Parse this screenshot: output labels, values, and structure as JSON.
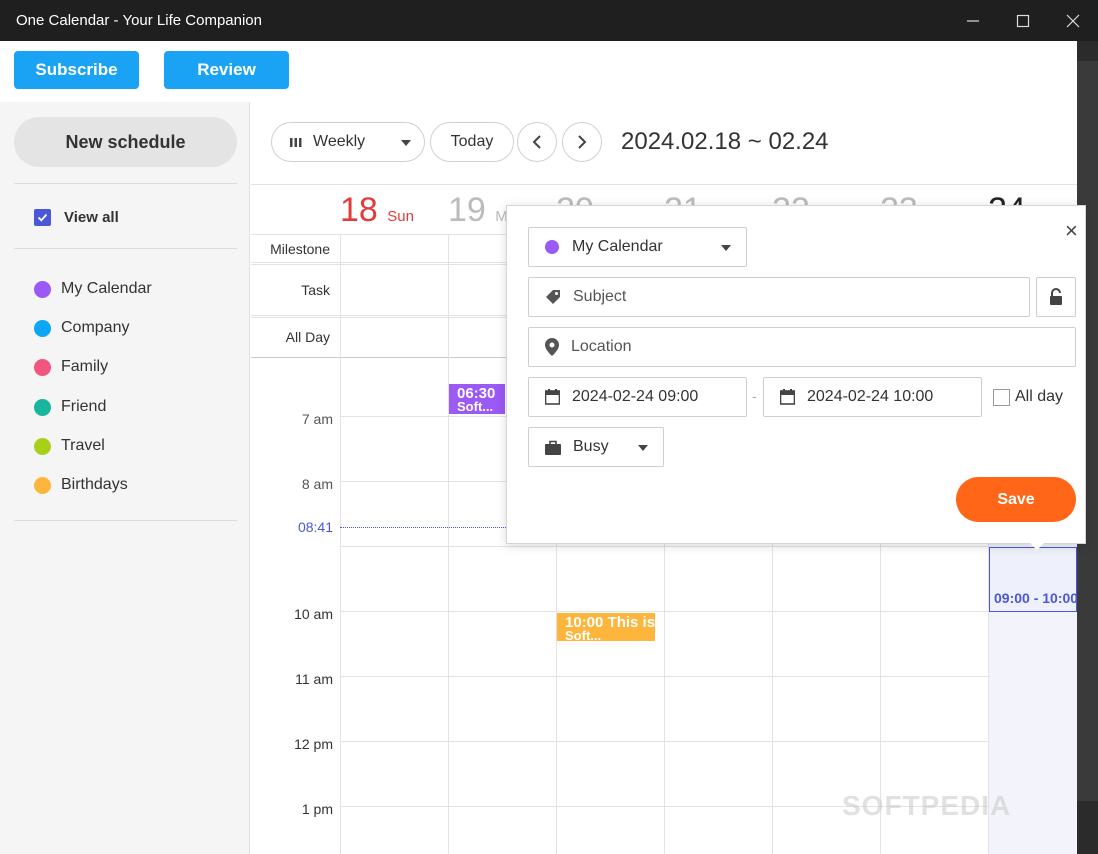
{
  "window": {
    "title": "One Calendar - Your Life Companion"
  },
  "topbar": {
    "subscribe_label": "Subscribe",
    "review_label": "Review"
  },
  "sidebar": {
    "new_schedule_label": "New schedule",
    "view_all_label": "View all",
    "calendars": [
      {
        "name": "My Calendar",
        "color": "#9b59f5"
      },
      {
        "name": "Company",
        "color": "#0ca6f4"
      },
      {
        "name": "Family",
        "color": "#f2557f"
      },
      {
        "name": "Friend",
        "color": "#18b69c"
      },
      {
        "name": "Travel",
        "color": "#a8d01b"
      },
      {
        "name": "Birthdays",
        "color": "#fdb63b"
      }
    ]
  },
  "toolbar": {
    "view_label": "Weekly",
    "today_label": "Today",
    "range": "2024.02.18 ~ 02.24"
  },
  "week": {
    "days": [
      {
        "num": "18",
        "name": "Sun",
        "color": "#e33b3b"
      },
      {
        "num": "19",
        "name": "M",
        "color": "#bbbbbb"
      },
      {
        "num": "20",
        "name": "",
        "color": "#bbbbbb"
      },
      {
        "num": "21",
        "name": "",
        "color": "#bbbbbb"
      },
      {
        "num": "22",
        "name": "",
        "color": "#bbbbbb"
      },
      {
        "num": "23",
        "name": "",
        "color": "#bbbbbb"
      },
      {
        "num": "24",
        "name": "",
        "color": "#222222"
      }
    ],
    "row_labels": {
      "milestone": "Milestone",
      "task": "Task",
      "allday": "All Day"
    },
    "times": [
      "7 am",
      "8 am",
      "10 am",
      "11 am",
      "12 pm",
      "1 pm"
    ],
    "current_time": "08:41",
    "events": [
      {
        "title": "06:30",
        "sub": "Soft...",
        "color": "#9b59f5"
      },
      {
        "title": "10:00 This is",
        "sub": "Soft...",
        "color": "#fdb63b"
      },
      {
        "title": "09:00 - 10:00",
        "sub": "",
        "color": "#4a58d8"
      }
    ]
  },
  "popup": {
    "calendar": "My Calendar",
    "calendar_color": "#9b59f5",
    "subject_placeholder": "Subject",
    "location_placeholder": "Location",
    "start": "2024-02-24 09:00",
    "end": "2024-02-24 10:00",
    "dash": "-",
    "allday_label": "All day",
    "state": "Busy",
    "save_label": "Save",
    "close": "×"
  },
  "watermark": "SOFTPEDIA"
}
